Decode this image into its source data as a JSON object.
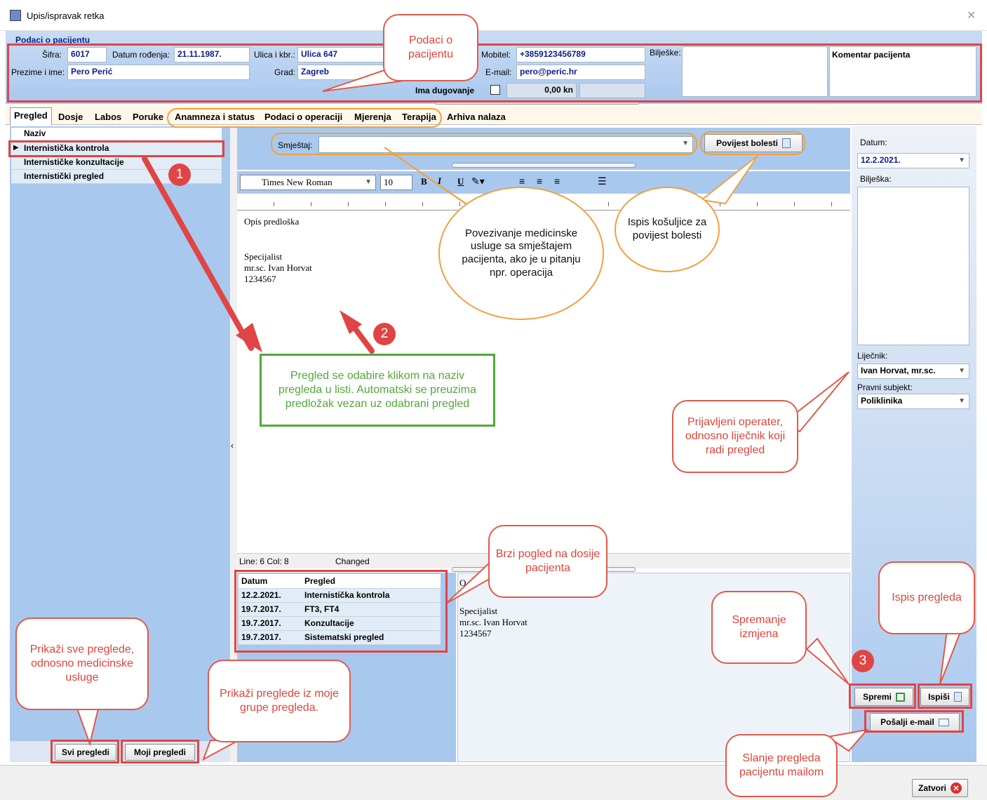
{
  "window": {
    "title": "Upis/ispravak retka",
    "close": "✕"
  },
  "patient": {
    "section": "Podaci o pacijentu",
    "sifra_label": "Šifra:",
    "sifra": "6017",
    "dob_label": "Datum rođenja:",
    "dob": "21.11.1987.",
    "street_label": "Ulica i kbr.:",
    "street": "Ulica 647",
    "name_label": "Prezime i ime:",
    "name": "Pero Perić",
    "city_label": "Grad:",
    "city": "Zagreb",
    "mobile_label": "Mobitel:",
    "mobile": "+3859123456789",
    "email_label": "E-mail:",
    "email": "pero@peric.hr",
    "debt_label": "Ima dugovanje",
    "debt_amount": "0,00 kn",
    "notes_label": "Bilješke:",
    "comment": "Komentar pacijenta"
  },
  "tabs": [
    "Pregled",
    "Dosje",
    "Labos",
    "Poruke",
    "Anamneza i status",
    "Podaci o operaciji",
    "Mjerenja",
    "Terapija",
    "Arhiva nalaza"
  ],
  "list": {
    "header": "Naziv",
    "items": [
      "Internistička kontrola",
      "Internističke konzultacije",
      "Internistički pregled"
    ]
  },
  "editor": {
    "smjestaj_label": "Smještaj:",
    "history_button": "Povijest bolesti",
    "font": "Times New Roman",
    "size": "10",
    "lines": [
      "Opis predloška",
      "",
      "Specijalist",
      "mr.sc. Ivan Horvat",
      "1234567"
    ],
    "status_line": "Line:  6 Col:  8",
    "status_changed": "Changed"
  },
  "dossier": {
    "headers": [
      "Datum",
      "Pregled"
    ],
    "rows": [
      [
        "12.2.2021.",
        "Internistička kontrola"
      ],
      [
        "19.7.2017.",
        "FT3, FT4"
      ],
      [
        "19.7.2017.",
        "Konzultacije"
      ],
      [
        "19.7.2017.",
        "Sistematski pregled"
      ]
    ]
  },
  "preview": {
    "first": "O",
    "lines": [
      "Specijalist",
      "mr.sc. Ivan Horvat",
      "1234567"
    ]
  },
  "right": {
    "date_label": "Datum:",
    "date": "12.2.2021.",
    "note_label": "Bilješka:",
    "doctor_label": "Liječnik:",
    "doctor": "Ivan Horvat, mr.sc.",
    "entity_label": "Pravni subjekt:",
    "entity": "Poliklinika"
  },
  "buttons": {
    "all": "Svi pregledi",
    "mine": "Moji pregledi",
    "save": "Spremi",
    "print": "Ispiši",
    "email": "Pošalji e-mail",
    "close": "Zatvori"
  },
  "callouts": {
    "patient": "Podaci o pacijentu",
    "link": "Povezivanje medicinske usluge sa smještajem pacijenta, ako je u pitanju npr. operacija",
    "history": "Ispis košuljice za povijest bolesti",
    "select": "Pregled se odabire klikom na naziv pregleda u listi. Automatski se preuzima predložak vezan uz odabrani pregled",
    "operator": "Prijavljeni operater, odnosno liječnik koji radi pregled",
    "dossier": "Brzi pogled na dosije pacijenta",
    "save": "Spremanje izmjena",
    "print": "Ispis pregleda",
    "all": "Prikaži sve preglede, odnosno medicinske usluge",
    "mine": "Prikaži preglede iz moje grupe pregleda.",
    "mail": "Slanje pregleda pacijentu mailom"
  },
  "numbers": [
    "1",
    "2",
    "3"
  ],
  "colors": {
    "panel": "#a9c8ee",
    "annotation_red": "#e04545",
    "annotation_orange": "#f0a040",
    "annotation_green": "#52a83a"
  }
}
